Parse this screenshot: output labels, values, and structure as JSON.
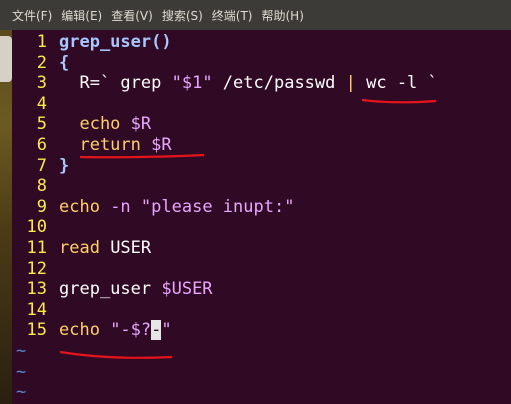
{
  "menubar": {
    "items": [
      "文件(F)",
      "编辑(E)",
      "查看(V)",
      "搜索(S)",
      "终端(T)",
      "帮助(H)"
    ]
  },
  "editor": {
    "lines": [
      {
        "num": "1",
        "segments": [
          {
            "t": "grep_user()",
            "c": "kw-fn"
          }
        ]
      },
      {
        "num": "2",
        "segments": [
          {
            "t": "{",
            "c": "brace"
          }
        ]
      },
      {
        "num": "3",
        "segments": [
          {
            "t": "  R=` ",
            "c": "plain"
          },
          {
            "t": "grep ",
            "c": "plain"
          },
          {
            "t": "\"$1\"",
            "c": "str"
          },
          {
            "t": " /etc/passwd ",
            "c": "plain"
          },
          {
            "t": "|",
            "c": "pipe"
          },
          {
            "t": " wc -l `",
            "c": "plain"
          }
        ]
      },
      {
        "num": "4",
        "segments": []
      },
      {
        "num": "5",
        "segments": [
          {
            "t": "  echo ",
            "c": "stmt"
          },
          {
            "t": "$R",
            "c": "var"
          }
        ]
      },
      {
        "num": "6",
        "segments": [
          {
            "t": "  return ",
            "c": "stmt"
          },
          {
            "t": "$R",
            "c": "var"
          }
        ]
      },
      {
        "num": "7",
        "segments": [
          {
            "t": "}",
            "c": "brace"
          }
        ]
      },
      {
        "num": "8",
        "segments": []
      },
      {
        "num": "9",
        "segments": [
          {
            "t": "echo ",
            "c": "stmt"
          },
          {
            "t": "-n ",
            "c": "opt"
          },
          {
            "t": "\"please inupt:\"",
            "c": "str"
          }
        ]
      },
      {
        "num": "10",
        "segments": []
      },
      {
        "num": "11",
        "segments": [
          {
            "t": "read ",
            "c": "stmt"
          },
          {
            "t": "USER",
            "c": "plain"
          }
        ]
      },
      {
        "num": "12",
        "segments": []
      },
      {
        "num": "13",
        "segments": [
          {
            "t": "grep_user ",
            "c": "plain"
          },
          {
            "t": "$USER",
            "c": "var"
          }
        ]
      },
      {
        "num": "14",
        "segments": []
      },
      {
        "num": "15",
        "segments": [
          {
            "t": "echo ",
            "c": "stmt"
          },
          {
            "t": "\"-$?",
            "c": "str"
          },
          {
            "t": "-",
            "c": "cursor"
          },
          {
            "t": "\"",
            "c": "str"
          }
        ]
      }
    ],
    "tilde_lines": [
      "~",
      "~",
      "~"
    ]
  },
  "colors": {
    "background": "#300a24",
    "line_numbers": "#fce94f",
    "annotation_underline": "#e5131a"
  }
}
